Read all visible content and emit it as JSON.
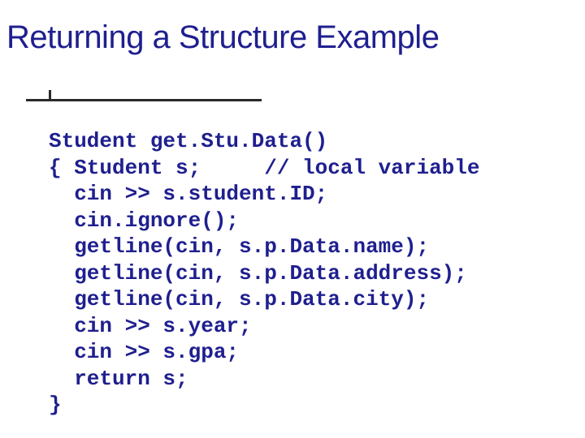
{
  "title": "Returning a Structure Example",
  "code": {
    "l0": "Student get.Stu.Data()",
    "l1": "{ Student s;     // local variable",
    "l2": "  cin >> s.student.ID;",
    "l3": "  cin.ignore();",
    "l4": "  getline(cin, s.p.Data.name);",
    "l5": "  getline(cin, s.p.Data.address);",
    "l6": "  getline(cin, s.p.Data.city);",
    "l7": "  cin >> s.year;",
    "l8": "  cin >> s.gpa;",
    "l9": "  return s;",
    "l10": "}"
  }
}
